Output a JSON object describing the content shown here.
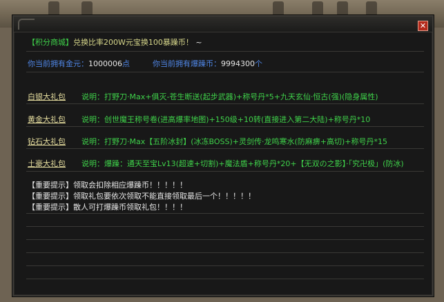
{
  "header": {
    "tag": "【积分商城】",
    "exchange_text": "兑换比率200W元宝换100暴躁币！",
    "tilde": "~"
  },
  "balance": {
    "gold_label": "你当前拥有金元：",
    "gold_value": "1000006",
    "gold_unit": "点",
    "coin_label": "你当前拥有爆躁币：",
    "coin_value": "9994300",
    "coin_unit": "个"
  },
  "packages": [
    {
      "name": "白银大礼包",
      "desc": "说明：打野刀·Max+俱灭-苍生断送(起步武器)+称号丹*5+九天玄仙·恒古(强)(隐身属性)"
    },
    {
      "name": "黄金大礼包",
      "desc": "说明：创世魔王称号卷(进高爆率地图)+150级+10转(直接进入第二大陆)+称号丹*10"
    },
    {
      "name": "钻石大礼包",
      "desc": "说明：打野刀·Max【五阶冰封】(冰冻BOSS)+灵剑传·龙鸣寒水(防麻痹+高切)+称号丹*15"
    },
    {
      "name": "土豪大礼包",
      "desc": "说明：爆躁：通天至宝Lv13(超速+切割)+魔法盾+称号丹*20+【无双の之影】·「究卍极」(防冰)"
    }
  ],
  "tips": [
    {
      "tag": "【重要提示】",
      "text": "领取会扣除相应爆躁币！！！！！"
    },
    {
      "tag": "【重要提示】",
      "text": "领取礼包要依次领取不能直接领取最后一个！！！！！"
    },
    {
      "tag": "【重要提示】",
      "text": "散人可打爆躁币领取礼包！！！！"
    }
  ],
  "icons": {
    "close": "close-icon"
  },
  "colors": {
    "green_text": "#3fd24a",
    "blue_text": "#4f86e6",
    "panel_bg": "#181818",
    "close_red": "#b42a1c"
  }
}
